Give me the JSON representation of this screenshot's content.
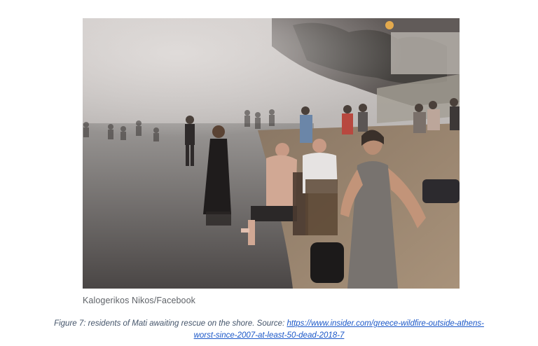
{
  "image": {
    "subject": "photo",
    "icon": "photo-icon"
  },
  "credit": "Kalogerikos Nikos/Facebook",
  "caption": {
    "prefix": "Figure 7: residents of Mati awaiting rescue on the shore. Source: ",
    "link_line1": "https://www.insider.com/greece-wildfire-outside-athens-",
    "link_line2": "worst-since-2007-at-least-50-dead-2018-7"
  }
}
